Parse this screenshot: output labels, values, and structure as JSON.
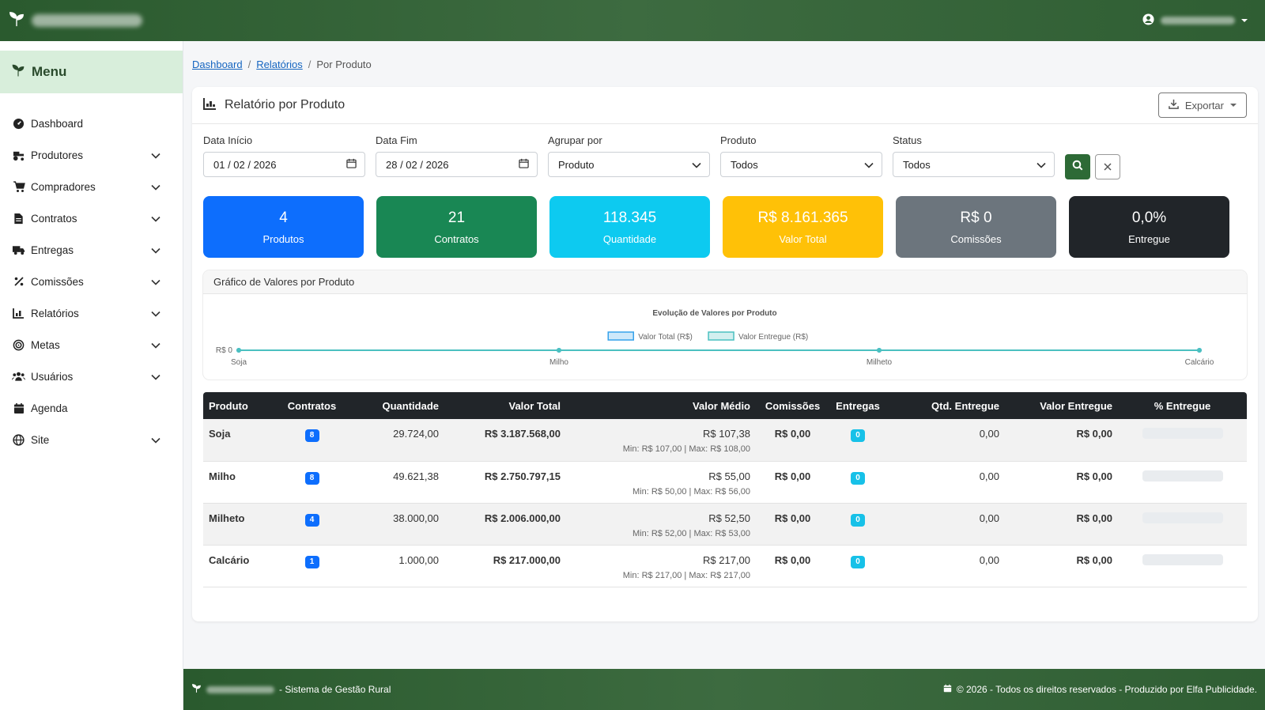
{
  "header": {
    "user_icon": "user-circle-icon"
  },
  "sidebar": {
    "title": "Menu",
    "items": [
      {
        "label": "Dashboard",
        "icon": "dashboard-icon",
        "expandable": false
      },
      {
        "label": "Produtores",
        "icon": "tractor-icon",
        "expandable": true
      },
      {
        "label": "Compradores",
        "icon": "cart-icon",
        "expandable": true
      },
      {
        "label": "Contratos",
        "icon": "contract-icon",
        "expandable": true
      },
      {
        "label": "Entregas",
        "icon": "truck-icon",
        "expandable": true
      },
      {
        "label": "Comissões",
        "icon": "percent-icon",
        "expandable": true
      },
      {
        "label": "Relatórios",
        "icon": "chart-icon",
        "expandable": true
      },
      {
        "label": "Metas",
        "icon": "target-icon",
        "expandable": true
      },
      {
        "label": "Usuários",
        "icon": "users-icon",
        "expandable": true
      },
      {
        "label": "Agenda",
        "icon": "calendar-icon",
        "expandable": false
      },
      {
        "label": "Site",
        "icon": "globe-icon",
        "expandable": true
      }
    ]
  },
  "breadcrumb": {
    "dashboard": "Dashboard",
    "reports": "Relatórios",
    "current": "Por Produto"
  },
  "report": {
    "title": "Relatório por Produto",
    "export_label": "Exportar",
    "filters": {
      "start_label": "Data Início",
      "start_value": "01 / 02 / 2026",
      "end_label": "Data Fim",
      "end_value": "28 / 02 / 2026",
      "group_label": "Agrupar por",
      "group_value": "Produto",
      "product_label": "Produto",
      "product_value": "Todos",
      "status_label": "Status",
      "status_value": "Todos"
    },
    "stats": [
      {
        "value": "4",
        "label": "Produtos",
        "color": "#0d6efd"
      },
      {
        "value": "21",
        "label": "Contratos",
        "color": "#198754"
      },
      {
        "value": "118.345",
        "label": "Quantidade",
        "color": "#0dcaf0"
      },
      {
        "value": "R$ 8.161.365",
        "label": "Valor Total",
        "color": "#ffc107"
      },
      {
        "value": "R$ 0",
        "label": "Comissões",
        "color": "#6c757d"
      },
      {
        "value": "0,0%",
        "label": "Entregue",
        "color": "#212529"
      }
    ],
    "chart_box_title": "Gráfico de Valores por Produto"
  },
  "chart_data": {
    "type": "line",
    "title": "Evolução de Valores por Produto",
    "categories": [
      "Soja",
      "Milho",
      "Milheto",
      "Calcário"
    ],
    "series": [
      {
        "name": "Valor Total (R$)",
        "values": [
          0,
          0,
          0,
          0
        ],
        "color": "#36a2eb"
      },
      {
        "name": "Valor Entregue (R$)",
        "values": [
          0,
          0,
          0,
          0
        ],
        "color": "#4bc0c0"
      }
    ],
    "y_tick_labels": [
      "R$ 0"
    ],
    "legend_position": "top"
  },
  "table": {
    "headers": [
      "Produto",
      "Contratos",
      "Quantidade",
      "Valor Total",
      "Valor Médio",
      "Comissões",
      "Entregas",
      "Qtd. Entregue",
      "Valor Entregue",
      "% Entregue"
    ],
    "rows": [
      {
        "produto": "Soja",
        "contratos": "8",
        "quantidade": "29.724,00",
        "valor_total": "R$ 3.187.568,00",
        "valor_medio": "R$ 107,38",
        "range": "Min: R$ 107,00 | Max: R$ 108,00",
        "comissoes": "R$ 0,00",
        "entregas": "0",
        "qtd_entregue": "0,00",
        "valor_entregue": "R$ 0,00",
        "pct_entregue": 0
      },
      {
        "produto": "Milho",
        "contratos": "8",
        "quantidade": "49.621,38",
        "valor_total": "R$ 2.750.797,15",
        "valor_medio": "R$ 55,00",
        "range": "Min: R$ 50,00 | Max: R$ 56,00",
        "comissoes": "R$ 0,00",
        "entregas": "0",
        "qtd_entregue": "0,00",
        "valor_entregue": "R$ 0,00",
        "pct_entregue": 0
      },
      {
        "produto": "Milheto",
        "contratos": "4",
        "quantidade": "38.000,00",
        "valor_total": "R$ 2.006.000,00",
        "valor_medio": "R$ 52,50",
        "range": "Min: R$ 52,00 | Max: R$ 53,00",
        "comissoes": "R$ 0,00",
        "entregas": "0",
        "qtd_entregue": "0,00",
        "valor_entregue": "R$ 0,00",
        "pct_entregue": 0
      },
      {
        "produto": "Calcário",
        "contratos": "1",
        "quantidade": "1.000,00",
        "valor_total": "R$ 217.000,00",
        "valor_medio": "R$ 217,00",
        "range": "Min: R$ 217,00 | Max: R$ 217,00",
        "comissoes": "R$ 0,00",
        "entregas": "0",
        "qtd_entregue": "0,00",
        "valor_entregue": "R$ 0,00",
        "pct_entregue": 0
      }
    ]
  },
  "footer": {
    "system": "- Sistema de Gestão Rural",
    "copyright": "© 2026 - Todos os direitos reservados - Produzido por Elfa Publicidade."
  }
}
